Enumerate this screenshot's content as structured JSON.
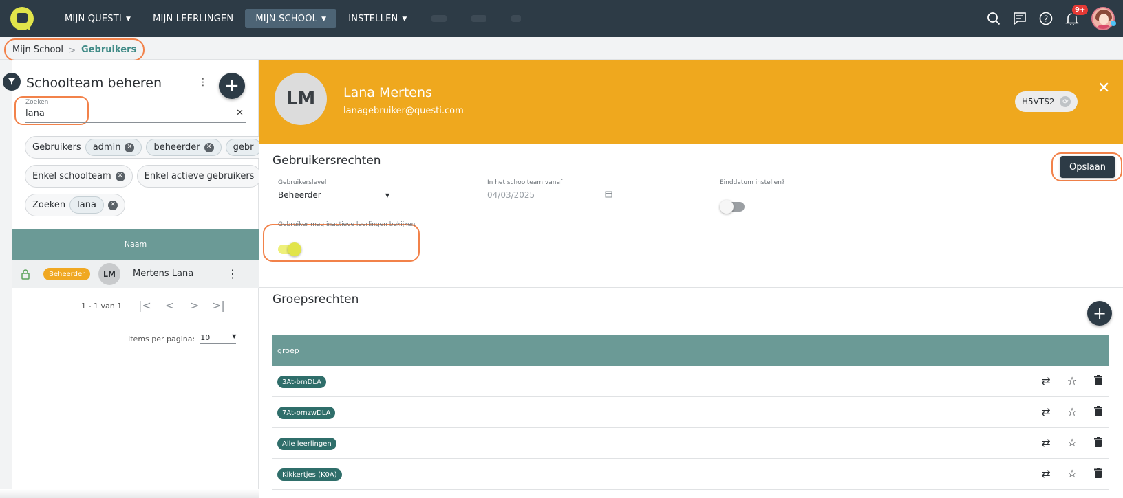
{
  "nav": {
    "items": [
      {
        "label": "MIJN QUESTI",
        "has_menu": true,
        "active": false
      },
      {
        "label": "MIJN LEERLINGEN",
        "has_menu": false,
        "active": false
      },
      {
        "label": "MIJN SCHOOL",
        "has_menu": true,
        "active": true
      },
      {
        "label": "INSTELLEN",
        "has_menu": true,
        "active": false
      }
    ],
    "notification_count": "9+",
    "icons": [
      "search-icon",
      "chat-icon",
      "help-icon",
      "bell-icon",
      "avatar"
    ]
  },
  "breadcrumb": {
    "root": "Mijn School",
    "current": "Gebruikers"
  },
  "left": {
    "title": "Schoolteam beheren",
    "search": {
      "label": "Zoeken",
      "value": "lana"
    },
    "filters": {
      "row1": {
        "label": "Gebruikers",
        "tags": [
          "admin",
          "beheerder",
          "gebr"
        ]
      },
      "row2": [
        "Enkel schoolteam",
        "Enkel actieve gebruikers"
      ],
      "row3": {
        "label": "Zoeken",
        "tags": [
          "lana"
        ]
      }
    },
    "table": {
      "header": "Naam",
      "rows": [
        {
          "role": "Beheerder",
          "initials": "LM",
          "name": "Mertens Lana"
        }
      ]
    },
    "pager": {
      "range": "1 - 1 van 1",
      "items_label": "Items per pagina:",
      "items_value": "10"
    }
  },
  "profile": {
    "initials": "LM",
    "name": "Lana Mertens",
    "email": "lanagebruiker@questi.com",
    "code": "H5VTS2"
  },
  "rights": {
    "title": "Gebruikersrechten",
    "save_label": "Opslaan",
    "level": {
      "label": "Gebruikerslevel",
      "value": "Beheerder"
    },
    "since": {
      "label": "In het schoolteam vanaf",
      "value": "04/03/2025"
    },
    "enddate": {
      "label": "Einddatum instellen?",
      "on": false
    },
    "inactive": {
      "label": "Gebruiker mag inactieve leerlingen bekijken",
      "on": true
    }
  },
  "groups": {
    "title": "Groepsrechten",
    "header": "groep",
    "rows": [
      "3At-bmDLA",
      "7At-omzwDLA",
      "Alle leerlingen",
      "Kikkertjes (K0A)"
    ]
  },
  "colors": {
    "nav_bg": "#2d3b46",
    "accent_orange": "#efa81e",
    "highlight_ring": "#f2824a",
    "table_header": "#6b9a96",
    "group_tag": "#2f6e6a",
    "toggle_on": "#e1e44a"
  }
}
